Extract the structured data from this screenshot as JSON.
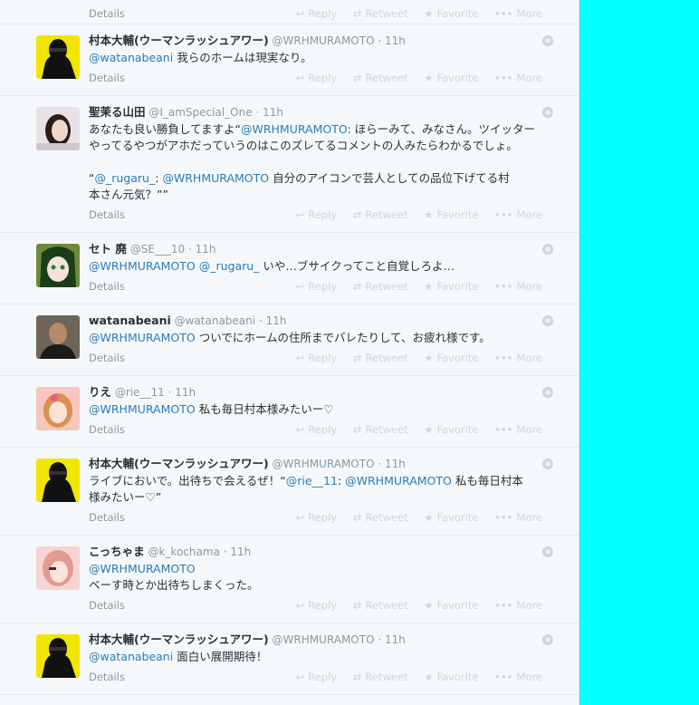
{
  "actions": {
    "details": "Details",
    "reply": "Reply",
    "retweet": "Retweet",
    "favorite": "Favorite",
    "more": "More",
    "reply_icon": "↩",
    "retweet_icon": "⇄",
    "favorite_icon": "★",
    "more_icon": "•••"
  },
  "tweets": [
    {
      "name": "村本大輔(ウーマンラッシュアワー)",
      "handle": "@WRHMURAMOTO",
      "time": "11h",
      "lines": [
        [
          {
            "t": "@watanabeani",
            "m": true
          },
          {
            "t": " 我らのホームは現実なり。",
            "m": false
          }
        ]
      ]
    },
    {
      "name": "聖茉る山田",
      "handle": "@I_amSpecial_One",
      "time": "11h",
      "lines": [
        [
          {
            "t": "あなたも良い勝負してますよ“",
            "m": false
          },
          {
            "t": "@WRHMURAMOTO",
            "m": true
          },
          {
            "t": ": ほらーみて、みなさん。ツイッター",
            "m": false
          }
        ],
        [
          {
            "t": "やってるやつがアホだっていうのはこのズレてるコメントの人みたらわかるでしょ。",
            "m": false
          }
        ],
        [],
        [
          {
            "t": "“",
            "m": false
          },
          {
            "t": "@_rugaru_",
            "m": true
          },
          {
            "t": ": ",
            "m": false
          },
          {
            "t": "@WRHMURAMOTO",
            "m": true
          },
          {
            "t": " 自分のアイコンで芸人としての品位下げてる村",
            "m": false
          }
        ],
        [
          {
            "t": "本さん元気？””",
            "m": false
          }
        ]
      ]
    },
    {
      "name": "セト 廃",
      "handle": "@SE___10",
      "time": "11h",
      "lines": [
        [
          {
            "t": "@WRHMURAMOTO",
            "m": true
          },
          {
            "t": " ",
            "m": false
          },
          {
            "t": "@_rugaru_",
            "m": true
          },
          {
            "t": " いや…ブサイクってこと自覚しろよ…",
            "m": false
          }
        ]
      ]
    },
    {
      "name": "watanabeani",
      "handle": "@watanabeani",
      "time": "11h",
      "lines": [
        [
          {
            "t": "@WRHMURAMOTO",
            "m": true
          },
          {
            "t": " ついでにホームの住所までバレたりして、お疲れ様です。",
            "m": false
          }
        ]
      ]
    },
    {
      "name": "りえ",
      "handle": "@rie__11",
      "time": "11h",
      "lines": [
        [
          {
            "t": "@WRHMURAMOTO",
            "m": true
          },
          {
            "t": " 私も毎日村本様みたいー♡",
            "m": false
          }
        ]
      ]
    },
    {
      "name": "村本大輔(ウーマンラッシュアワー)",
      "handle": "@WRHMURAMOTO",
      "time": "11h",
      "lines": [
        [
          {
            "t": "ライブにおいで。出待ちで会えるぜ！“",
            "m": false
          },
          {
            "t": "@rie__11",
            "m": true
          },
          {
            "t": ": ",
            "m": false
          },
          {
            "t": "@WRHMURAMOTO",
            "m": true
          },
          {
            "t": " 私も毎日村本",
            "m": false
          }
        ],
        [
          {
            "t": "様みたいー♡”",
            "m": false
          }
        ]
      ]
    },
    {
      "name": "こっちゃま",
      "handle": "@k_kochama",
      "time": "11h",
      "lines": [
        [
          {
            "t": "@WRHMURAMOTO",
            "m": true
          }
        ],
        [
          {
            "t": "ベーす時とか出待ちしまくった。",
            "m": false
          }
        ]
      ]
    },
    {
      "name": "村本大輔(ウーマンラッシュアワー)",
      "handle": "@WRHMURAMOTO",
      "time": "11h",
      "lines": [
        [
          {
            "t": "@watanabeani",
            "m": true
          },
          {
            "t": " 面白い展開期待！",
            "m": false
          }
        ]
      ]
    }
  ]
}
